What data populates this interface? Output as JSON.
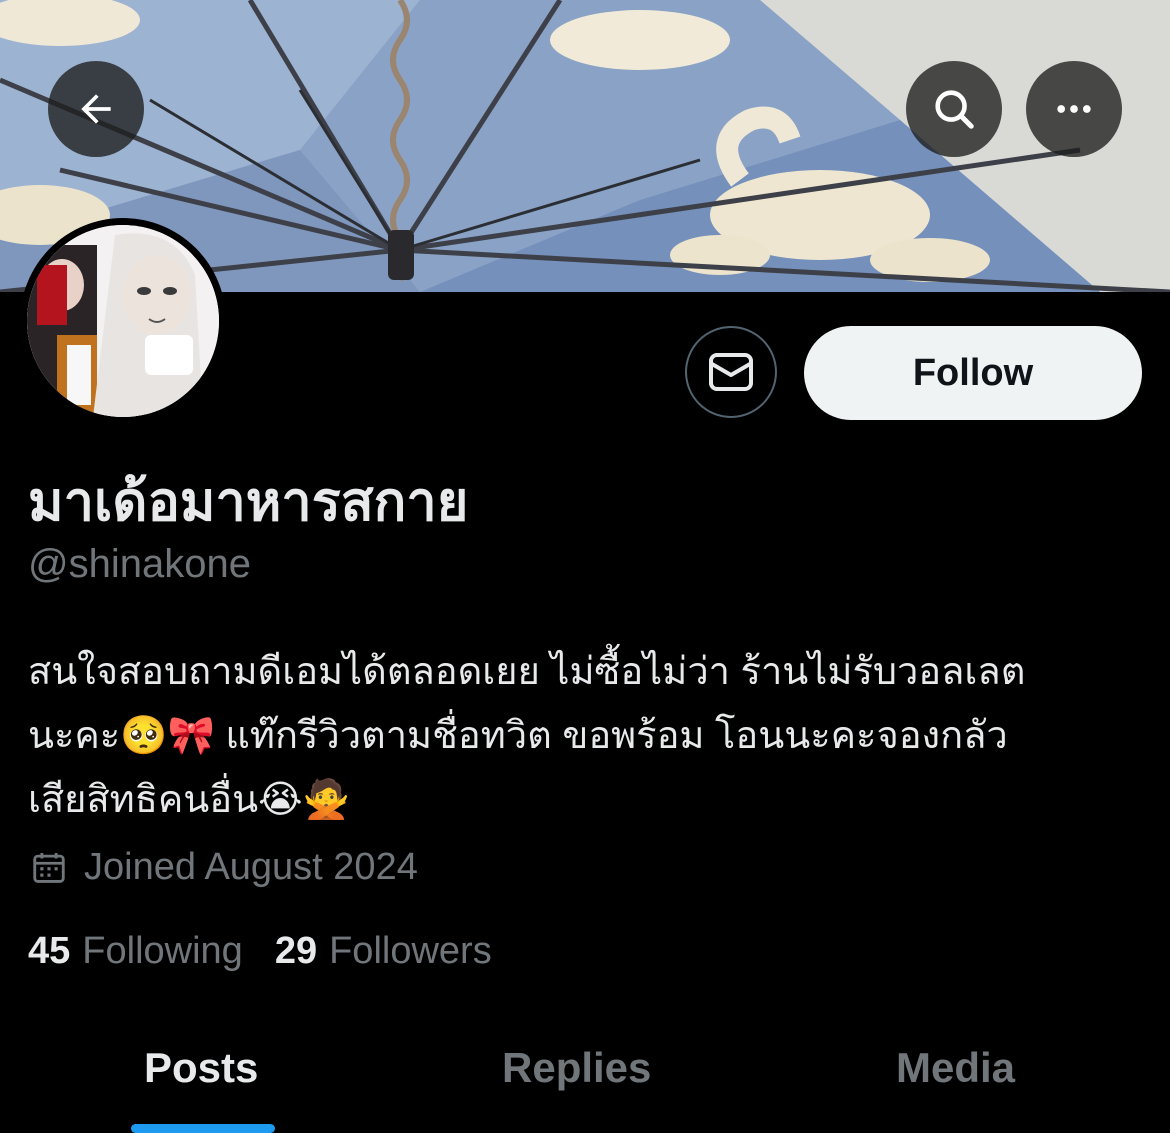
{
  "colors": {
    "background": "#000000",
    "primary_text": "#e7e9ea",
    "secondary_text": "#71767b",
    "accent": "#1d9bf0",
    "follow_button_bg": "#eff3f4"
  },
  "header": {
    "back_icon": "arrow-left-icon",
    "search_icon": "search-icon",
    "more_icon": "more-horizontal-icon"
  },
  "profile": {
    "display_name": "มาเด้อมาหารสกาย",
    "handle": "@shinakone",
    "bio_lines": [
      "สนใจสอบถามดีเอมได้ตลอดเยย ไม่ซื้อไม่ว่า ร้านไม่รับวอลเลต",
      "นะคะ🥺🎀 แท๊กรีวิวตามชื่อทวิต ขอพร้อม โอนนะคะจองกลัว",
      "เสียสิทธิคนอื่น😭🙅"
    ],
    "joined": "Joined August 2024",
    "following_count": "45",
    "following_label": "Following",
    "followers_count": "29",
    "followers_label": "Followers"
  },
  "actions": {
    "message_icon": "mail-icon",
    "follow_label": "Follow"
  },
  "tabs": [
    {
      "label": "Posts",
      "active": true
    },
    {
      "label": "Replies",
      "active": false
    },
    {
      "label": "Media",
      "active": false
    }
  ]
}
